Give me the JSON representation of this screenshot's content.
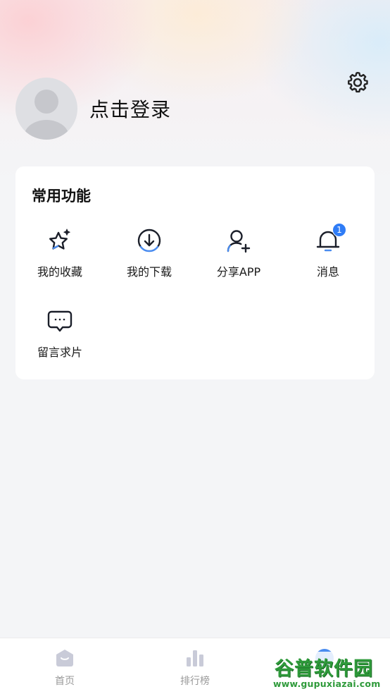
{
  "profile": {
    "login_label": "点击登录"
  },
  "common_functions": {
    "title": "常用功能",
    "items": [
      {
        "label": "我的收藏",
        "icon": "star-sparkle-icon"
      },
      {
        "label": "我的下载",
        "icon": "download-icon"
      },
      {
        "label": "分享APP",
        "icon": "add-user-icon"
      },
      {
        "label": "消息",
        "icon": "bell-icon",
        "badge": "1"
      },
      {
        "label": "留言求片",
        "icon": "chat-bubble-icon"
      }
    ]
  },
  "tabbar": {
    "items": [
      {
        "label": "首页",
        "icon": "home-icon"
      },
      {
        "label": "排行榜",
        "icon": "bar-chart-icon"
      },
      {
        "label": "",
        "icon": "profile-icon"
      }
    ]
  },
  "watermark": {
    "brand": "谷普软件园",
    "url": "www.gupuxiazai.com"
  },
  "colors": {
    "accent": "#2f7cf6",
    "page_bg": "#f4f5f7",
    "card_bg": "#ffffff",
    "tab_inactive": "#c5c8d6"
  }
}
